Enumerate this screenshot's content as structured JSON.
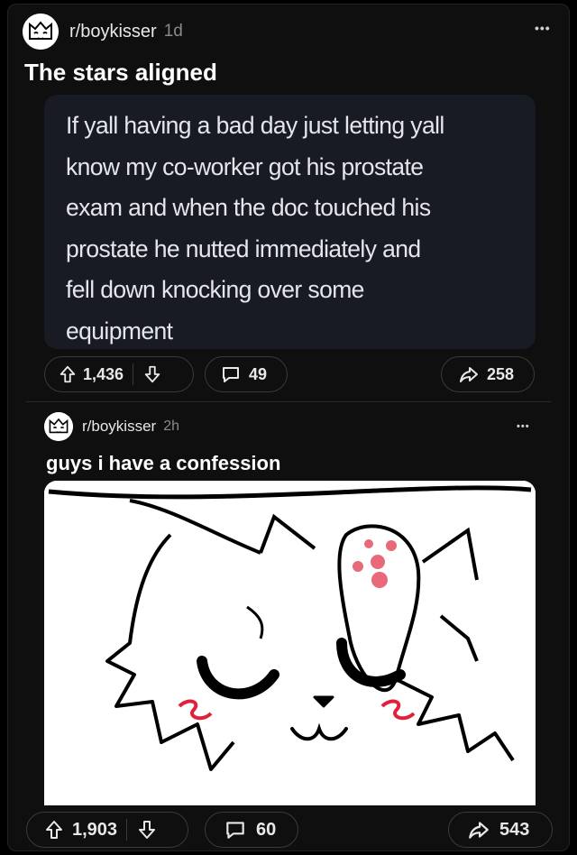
{
  "post1": {
    "subreddit": "r/boykisser",
    "age": "1d",
    "title": "The stars aligned",
    "quote_lines": [
      "If yall having a bad day just letting yall",
      "know my co-worker got his prostate",
      "exam and when the doc touched his",
      "prostate he nutted immediately and",
      "fell down knocking over some",
      "equipment"
    ],
    "upvotes": "1,436",
    "comments": "49",
    "shares": "258"
  },
  "post2": {
    "subreddit": "r/boykisser",
    "age": "2h",
    "title": "guys i have a confession",
    "upvotes": "1,903",
    "comments": "60",
    "shares": "543"
  },
  "more_label": "•••",
  "colors": {
    "background": "#000000",
    "card": "#0f0f10",
    "quote_bg": "#181b24",
    "pill_border": "#3a3a3a",
    "blush": "#e0213a",
    "paw": "#e86a7a"
  }
}
